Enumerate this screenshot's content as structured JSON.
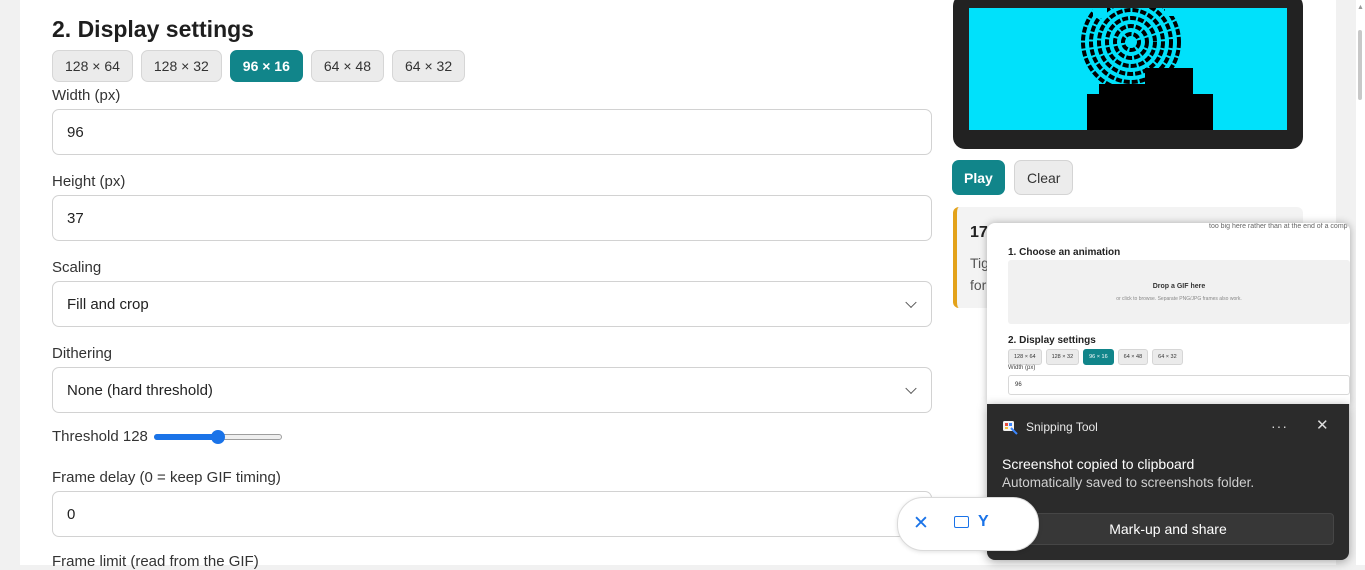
{
  "settings": {
    "title": "2. Display settings",
    "presets": [
      "128 × 64",
      "128 × 32",
      "96 × 16",
      "64 × 48",
      "64 × 32"
    ],
    "active_preset": "96 × 16",
    "width_label": "Width (px)",
    "width_value": "96",
    "height_label": "Height (px)",
    "height_value": "37",
    "scaling_label": "Scaling",
    "scaling_value": "Fill and crop",
    "dithering_label": "Dithering",
    "dithering_value": "None (hard threshold)",
    "threshold_label": "Threshold 128",
    "threshold_value": 128,
    "threshold_max": 255,
    "frame_delay_label": "Frame delay (0 = keep GIF timing)",
    "frame_delay_value": "0",
    "frame_limit_label": "Frame limit (read from the GIF)"
  },
  "preview": {
    "screen_color": "#00e1fb",
    "play_label": "Play",
    "clear_label": "Clear"
  },
  "info_card": {
    "title": "17",
    "line1": "Tig",
    "line2": "for",
    "accent": "#e3a21a"
  },
  "thumbnail": {
    "note": "too big here rather than at the end of a comp",
    "h1": "1. Choose an animation",
    "drop_title": "Drop a GIF here",
    "drop_sub": "or click to browse. Separate PNG/JPG frames also work.",
    "h2": "2. Display settings",
    "presets": [
      "128 × 64",
      "128 × 32",
      "96 × 16",
      "64 × 48",
      "64 × 32"
    ],
    "width_label": "Width (px)",
    "width_value": "96"
  },
  "toast": {
    "app": "Snipping Tool",
    "more": "···",
    "close": "✕",
    "heading": "Screenshot copied to clipboard",
    "body": "Automatically saved to screenshots folder.",
    "action": "Mark-up and share"
  },
  "pill": {
    "close": "✕",
    "text": "Y"
  },
  "colors": {
    "accent": "#11858a",
    "slider": "#1a73e8"
  }
}
